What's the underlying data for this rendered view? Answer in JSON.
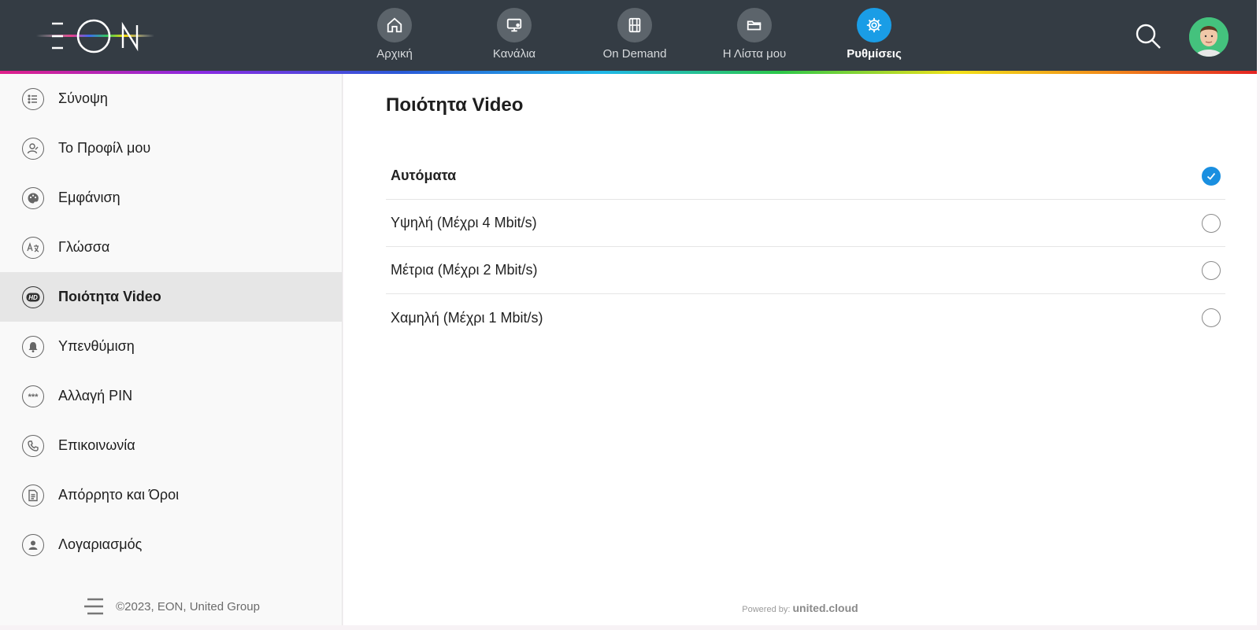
{
  "brand": {
    "logo_text": "EON"
  },
  "nav": {
    "items": [
      {
        "label": "Αρχική",
        "icon": "home-icon"
      },
      {
        "label": "Κανάλια",
        "icon": "tv-icon"
      },
      {
        "label": "On Demand",
        "icon": "film-icon"
      },
      {
        "label": "Η Λίστα μου",
        "icon": "folder-icon"
      },
      {
        "label": "Ρυθμίσεις",
        "icon": "gear-icon",
        "active": true
      }
    ]
  },
  "sidebar": {
    "items": [
      {
        "label": "Σύνοψη",
        "icon": "list-icon"
      },
      {
        "label": "Το Προφίλ μου",
        "icon": "profile-edit-icon"
      },
      {
        "label": "Εμφάνιση",
        "icon": "palette-icon"
      },
      {
        "label": "Γλώσσα",
        "icon": "language-icon"
      },
      {
        "label": "Ποιότητα Video",
        "icon": "hd-icon",
        "active": true
      },
      {
        "label": "Υπενθύμιση",
        "icon": "bell-icon"
      },
      {
        "label": "Αλλαγή PIN",
        "icon": "pin-icon"
      },
      {
        "label": "Επικοινωνία",
        "icon": "phone-icon"
      },
      {
        "label": "Απόρρητο και Όροι",
        "icon": "document-icon"
      },
      {
        "label": "Λογαριασμός",
        "icon": "account-icon"
      }
    ],
    "footer": "©2023, EON, United Group"
  },
  "main": {
    "title": "Ποιότητα Video",
    "options": [
      {
        "label": "Αυτόματα",
        "selected": true
      },
      {
        "label": "Υψηλή (Μέχρι 4 Mbit/s)",
        "selected": false
      },
      {
        "label": "Μέτρια (Μέχρι 2 Mbit/s)",
        "selected": false
      },
      {
        "label": "Χαμηλή (Μέχρι 1 Mbit/s)",
        "selected": false
      }
    ],
    "powered_prefix": "Powered by:",
    "powered_brand": "united.cloud"
  },
  "colors": {
    "topbar": "#343c44",
    "accent": "#1a9de6",
    "active_row": "#e6e6e6"
  }
}
